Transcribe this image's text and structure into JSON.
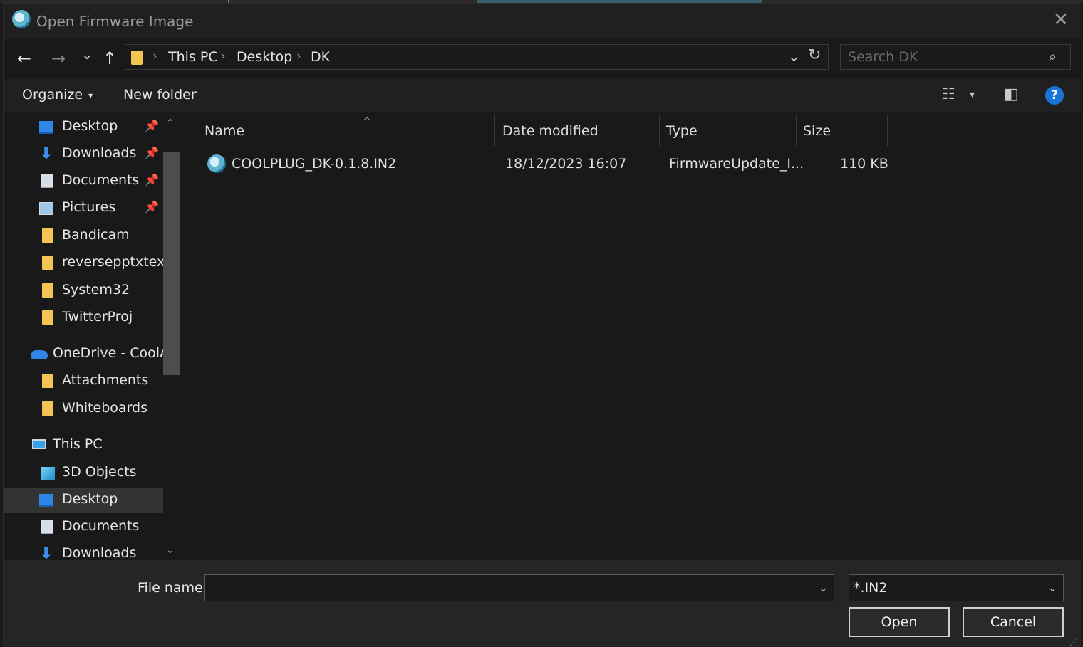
{
  "window": {
    "title": "Open Firmware Image",
    "close_glyph": "✕"
  },
  "nav": {
    "back_glyph": "←",
    "forward_glyph": "→",
    "recent_glyph": "⌄",
    "up_glyph": "↑",
    "breadcrumbs": [
      "This PC",
      "Desktop",
      "DK"
    ],
    "crumb_sep": "›",
    "dropdown_glyph": "⌄",
    "refresh_glyph": "↻"
  },
  "search": {
    "placeholder": "Search DK",
    "icon_glyph": "⌕"
  },
  "toolbar": {
    "organize_label": "Organize",
    "organize_caret": "▾",
    "new_folder_label": "New folder",
    "view_glyph": "☷",
    "view_caret": "▾",
    "preview_glyph": "◧",
    "help_glyph": "?"
  },
  "sidebar": {
    "pin_glyph": "📌",
    "scroll_up": "⌃",
    "scroll_down": "⌄",
    "items": [
      {
        "label": "Desktop",
        "icon": "desktop-icon",
        "pinned": true
      },
      {
        "label": "Downloads",
        "icon": "download-icon",
        "pinned": true
      },
      {
        "label": "Documents",
        "icon": "documents-icon",
        "pinned": true
      },
      {
        "label": "Pictures",
        "icon": "pictures-icon",
        "pinned": true
      },
      {
        "label": "Bandicam",
        "icon": "folder-icon"
      },
      {
        "label": "reversepptxtext",
        "icon": "folder-icon"
      },
      {
        "label": "System32",
        "icon": "folder-icon"
      },
      {
        "label": "TwitterProj",
        "icon": "folder-icon"
      },
      {
        "label": "OneDrive - CoolA",
        "icon": "onedrive-icon"
      },
      {
        "label": "Attachments",
        "icon": "folder-icon"
      },
      {
        "label": "Whiteboards",
        "icon": "folder-icon"
      },
      {
        "label": "This PC",
        "icon": "this-pc-icon"
      },
      {
        "label": "3D Objects",
        "icon": "3d-objects-icon"
      },
      {
        "label": "Desktop",
        "icon": "desktop-icon",
        "selected": true
      },
      {
        "label": "Documents",
        "icon": "documents-icon"
      },
      {
        "label": "Downloads",
        "icon": "download-icon"
      }
    ]
  },
  "filelist": {
    "sort_caret": "^",
    "columns": [
      "Name",
      "Date modified",
      "Type",
      "Size"
    ],
    "rows": [
      {
        "name": "COOLPLUG_DK-0.1.8.IN2",
        "date": "18/12/2023 16:07",
        "type": "FirmwareUpdate_I...",
        "size": "110 KB"
      }
    ]
  },
  "footer": {
    "file_name_label": "File name:",
    "file_name_value": "",
    "filter_value": "*.IN2",
    "dropdown_glyph": "⌄",
    "open_label": "Open",
    "cancel_label": "Cancel",
    "grip_glyph": "⋰"
  },
  "colors": {
    "background": "#191919",
    "titlebar": "#202020",
    "folder": "#f3c552",
    "accent": "#2f86e6",
    "help": "#1a73d9"
  }
}
